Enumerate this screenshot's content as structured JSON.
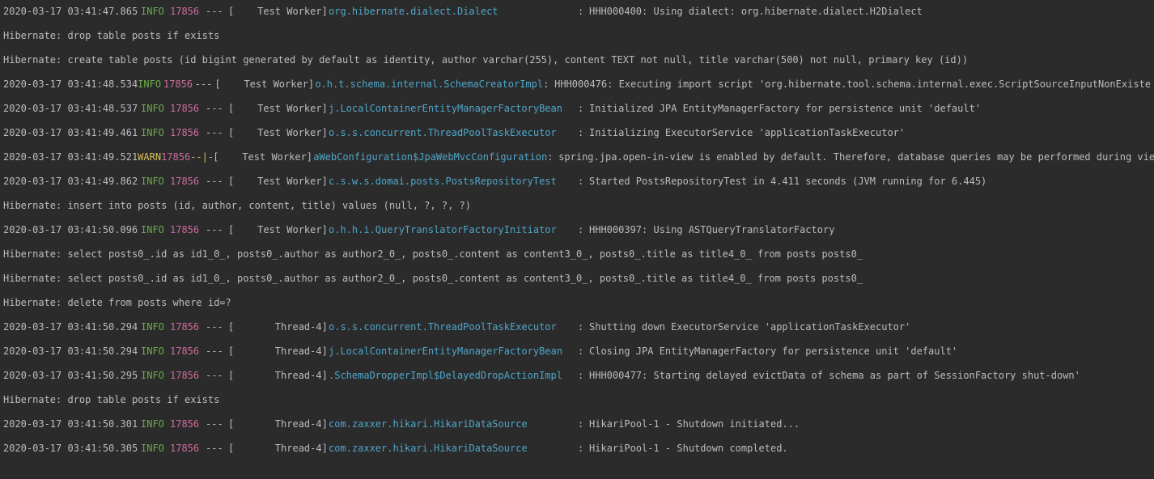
{
  "log": [
    {
      "type": "log",
      "ts": "2020-03-17 03:41:47.865",
      "level": "INFO",
      "pid": "17856",
      "dash": "---",
      "thread": "[    Test Worker]",
      "logger": "org.hibernate.dialect.Dialect",
      "msg": "HHH000400: Using dialect: org.hibernate.dialect.H2Dialect"
    },
    {
      "type": "hib",
      "text": "Hibernate: drop table posts if exists"
    },
    {
      "type": "hib",
      "text": "Hibernate: create table posts (id bigint generated by default as identity, author varchar(255), content TEXT not null, title varchar(500) not null, primary key (id))"
    },
    {
      "type": "log",
      "ts": "2020-03-17 03:41:48.534",
      "level": "INFO",
      "pid": "17856",
      "dash": "---",
      "thread": "[    Test Worker]",
      "logger": "o.h.t.schema.internal.SchemaCreatorImpl",
      "msg": "HHH000476: Executing import script 'org.hibernate.tool.schema.internal.exec.ScriptSourceInputNonExiste"
    },
    {
      "type": "log",
      "ts": "2020-03-17 03:41:48.537",
      "level": "INFO",
      "pid": "17856",
      "dash": "---",
      "thread": "[    Test Worker]",
      "logger": "j.LocalContainerEntityManagerFactoryBean",
      "msg": "Initialized JPA EntityManagerFactory for persistence unit 'default'"
    },
    {
      "type": "log",
      "ts": "2020-03-17 03:41:49.461",
      "level": "INFO",
      "pid": "17856",
      "dash": "---",
      "thread": "[    Test Worker]",
      "logger": "o.s.s.concurrent.ThreadPoolTaskExecutor",
      "msg": "Initializing ExecutorService 'applicationTaskExecutor'"
    },
    {
      "type": "log",
      "ts": "2020-03-17 03:41:49.521",
      "level": "WARN",
      "pid": "17856",
      "dash": "--|-",
      "thread": "[    Test Worker]",
      "logger": "aWebConfiguration$JpaWebMvcConfiguration",
      "msg": "spring.jpa.open-in-view is enabled by default. Therefore, database queries may be performed during vie"
    },
    {
      "type": "log",
      "ts": "2020-03-17 03:41:49.862",
      "level": "INFO",
      "pid": "17856",
      "dash": "---",
      "thread": "[    Test Worker]",
      "logger": "c.s.w.s.domai.posts.PostsRepositoryTest",
      "msg": "Started PostsRepositoryTest in 4.411 seconds (JVM running for 6.445)"
    },
    {
      "type": "hib",
      "text": "Hibernate: insert into posts (id, author, content, title) values (null, ?, ?, ?)"
    },
    {
      "type": "log",
      "ts": "2020-03-17 03:41:50.096",
      "level": "INFO",
      "pid": "17856",
      "dash": "---",
      "thread": "[    Test Worker]",
      "logger": "o.h.h.i.QueryTranslatorFactoryInitiator",
      "msg": "HHH000397: Using ASTQueryTranslatorFactory"
    },
    {
      "type": "hib",
      "text": "Hibernate: select posts0_.id as id1_0_, posts0_.author as author2_0_, posts0_.content as content3_0_, posts0_.title as title4_0_ from posts posts0_"
    },
    {
      "type": "hib",
      "text": "Hibernate: select posts0_.id as id1_0_, posts0_.author as author2_0_, posts0_.content as content3_0_, posts0_.title as title4_0_ from posts posts0_"
    },
    {
      "type": "hib",
      "text": "Hibernate: delete from posts where id=?"
    },
    {
      "type": "log",
      "ts": "2020-03-17 03:41:50.294",
      "level": "INFO",
      "pid": "17856",
      "dash": "---",
      "thread": "[       Thread-4]",
      "logger": "o.s.s.concurrent.ThreadPoolTaskExecutor",
      "msg": "Shutting down ExecutorService 'applicationTaskExecutor'"
    },
    {
      "type": "log",
      "ts": "2020-03-17 03:41:50.294",
      "level": "INFO",
      "pid": "17856",
      "dash": "---",
      "thread": "[       Thread-4]",
      "logger": "j.LocalContainerEntityManagerFactoryBean",
      "msg": "Closing JPA EntityManagerFactory for persistence unit 'default'"
    },
    {
      "type": "log",
      "ts": "2020-03-17 03:41:50.295",
      "level": "INFO",
      "pid": "17856",
      "dash": "---",
      "thread": "[       Thread-4]",
      "logger": ".SchemaDropperImpl$DelayedDropActionImpl",
      "msg": "HHH000477: Starting delayed evictData of schema as part of SessionFactory shut-down'"
    },
    {
      "type": "hib",
      "text": "Hibernate: drop table posts if exists"
    },
    {
      "type": "log",
      "ts": "2020-03-17 03:41:50.301",
      "level": "INFO",
      "pid": "17856",
      "dash": "---",
      "thread": "[       Thread-4]",
      "logger": "com.zaxxer.hikari.HikariDataSource",
      "msg": "HikariPool-1 - Shutdown initiated..."
    },
    {
      "type": "log",
      "ts": "2020-03-17 03:41:50.305",
      "level": "INFO",
      "pid": "17856",
      "dash": "---",
      "thread": "[       Thread-4]",
      "logger": "com.zaxxer.hikari.HikariDataSource",
      "msg": "HikariPool-1 - Shutdown completed."
    }
  ]
}
